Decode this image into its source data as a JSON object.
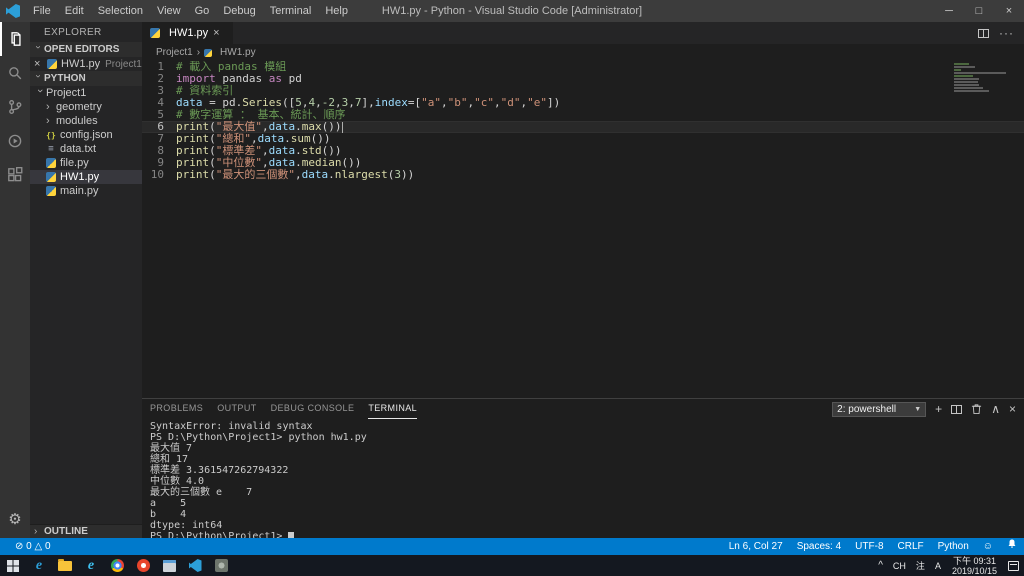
{
  "title_bar": {
    "title": "HW1.py - Python - Visual Studio Code [Administrator]",
    "menus": [
      "File",
      "Edit",
      "Selection",
      "View",
      "Go",
      "Debug",
      "Terminal",
      "Help"
    ]
  },
  "activity_bar": {
    "items": [
      "explorer",
      "search",
      "source-control",
      "debug",
      "extensions"
    ],
    "bottom": "settings"
  },
  "sidebar": {
    "title": "EXPLORER",
    "open_editors": {
      "header": "OPEN EDITORS",
      "items": [
        {
          "file": "HW1.py",
          "folder": "Project1",
          "icon": "py"
        }
      ]
    },
    "workspace": {
      "header": "PYTHON",
      "tree": [
        {
          "label": "Project1",
          "type": "folder-open",
          "level": 0
        },
        {
          "label": "geometry",
          "type": "folder",
          "level": 1
        },
        {
          "label": "modules",
          "type": "folder",
          "level": 1
        },
        {
          "label": "config.json",
          "type": "json",
          "level": 1
        },
        {
          "label": "data.txt",
          "type": "txt",
          "level": 1
        },
        {
          "label": "file.py",
          "type": "py",
          "level": 1
        },
        {
          "label": "HW1.py",
          "type": "py",
          "level": 1,
          "selected": true
        },
        {
          "label": "main.py",
          "type": "py",
          "level": 1
        }
      ]
    },
    "outline_header": "OUTLINE"
  },
  "editor": {
    "tab": "HW1.py",
    "breadcrumb": [
      "Project1",
      "HW1.py"
    ],
    "lines": [
      {
        "num": "1",
        "segs": [
          [
            "c",
            "# 載入 pandas 模組"
          ]
        ]
      },
      {
        "num": "2",
        "segs": [
          [
            "k",
            "import"
          ],
          [
            "p",
            " pandas "
          ],
          [
            "k",
            "as"
          ],
          [
            "p",
            " pd"
          ]
        ]
      },
      {
        "num": "3",
        "segs": [
          [
            "c",
            "# 資料索引"
          ]
        ]
      },
      {
        "num": "4",
        "segs": [
          [
            "v",
            "data"
          ],
          [
            "p",
            " = pd."
          ],
          [
            "f",
            "Series"
          ],
          [
            "p",
            "(["
          ],
          [
            "n",
            "5"
          ],
          [
            "p",
            ","
          ],
          [
            "n",
            "4"
          ],
          [
            "p",
            ","
          ],
          [
            "n",
            "-2"
          ],
          [
            "p",
            ","
          ],
          [
            "n",
            "3"
          ],
          [
            "p",
            ","
          ],
          [
            "n",
            "7"
          ],
          [
            "p",
            "],"
          ],
          [
            "v",
            "index"
          ],
          [
            "p",
            "=["
          ],
          [
            "s",
            "\"a\""
          ],
          [
            "p",
            ","
          ],
          [
            "s",
            "\"b\""
          ],
          [
            "p",
            ","
          ],
          [
            "s",
            "\"c\""
          ],
          [
            "p",
            ","
          ],
          [
            "s",
            "\"d\""
          ],
          [
            "p",
            ","
          ],
          [
            "s",
            "\"e\""
          ],
          [
            "p",
            "])"
          ]
        ]
      },
      {
        "num": "5",
        "segs": [
          [
            "c",
            "# 數字運算 ： 基本、統計、順序"
          ]
        ]
      },
      {
        "num": "6",
        "current": true,
        "segs": [
          [
            "f",
            "print"
          ],
          [
            "p",
            "("
          ],
          [
            "s",
            "\"最大值\""
          ],
          [
            "p",
            ","
          ],
          [
            "v",
            "data"
          ],
          [
            "p",
            "."
          ],
          [
            "f",
            "max"
          ],
          [
            "p",
            "())"
          ]
        ]
      },
      {
        "num": "7",
        "segs": [
          [
            "f",
            "print"
          ],
          [
            "p",
            "("
          ],
          [
            "s",
            "\"總和\""
          ],
          [
            "p",
            ","
          ],
          [
            "v",
            "data"
          ],
          [
            "p",
            "."
          ],
          [
            "f",
            "sum"
          ],
          [
            "p",
            "())"
          ]
        ]
      },
      {
        "num": "8",
        "segs": [
          [
            "f",
            "print"
          ],
          [
            "p",
            "("
          ],
          [
            "s",
            "\"標準差\""
          ],
          [
            "p",
            ","
          ],
          [
            "v",
            "data"
          ],
          [
            "p",
            "."
          ],
          [
            "f",
            "std"
          ],
          [
            "p",
            "())"
          ]
        ]
      },
      {
        "num": "9",
        "segs": [
          [
            "f",
            "print"
          ],
          [
            "p",
            "("
          ],
          [
            "s",
            "\"中位數\""
          ],
          [
            "p",
            ","
          ],
          [
            "v",
            "data"
          ],
          [
            "p",
            "."
          ],
          [
            "f",
            "median"
          ],
          [
            "p",
            "())"
          ]
        ]
      },
      {
        "num": "10",
        "segs": [
          [
            "f",
            "print"
          ],
          [
            "p",
            "("
          ],
          [
            "s",
            "\"最大的三個數\""
          ],
          [
            "p",
            ","
          ],
          [
            "v",
            "data"
          ],
          [
            "p",
            "."
          ],
          [
            "f",
            "nlargest"
          ],
          [
            "p",
            "("
          ],
          [
            "n",
            "3"
          ],
          [
            "p",
            "))"
          ]
        ]
      }
    ]
  },
  "panel": {
    "tabs": [
      {
        "label": "PROBLEMS"
      },
      {
        "label": "OUTPUT"
      },
      {
        "label": "DEBUG CONSOLE"
      },
      {
        "label": "TERMINAL",
        "active": true
      }
    ],
    "shell_selector": "2: powershell",
    "terminal_lines": [
      "SyntaxError: invalid syntax",
      "PS D:\\Python\\Project1> python hw1.py",
      "最大值 7",
      "總和 17",
      "標準差 3.361547262794322",
      "中位數 4.0",
      "最大的三個數 e    7",
      "a    5",
      "b    4",
      "dtype: int64",
      "PS D:\\Python\\Project1> "
    ]
  },
  "status_bar": {
    "errors": "0",
    "warnings": "0",
    "line_col": "Ln 6, Col 27",
    "indent": "Spaces: 4",
    "encoding": "UTF-8",
    "eol": "CRLF",
    "language": "Python"
  },
  "taskbar": {
    "icons": [
      "start",
      "edge",
      "file-explorer",
      "ie",
      "chrome",
      "red-browser",
      "app-window",
      "vscode",
      "gray-app"
    ],
    "tray": {
      "expand": "^",
      "ime": [
        "CH",
        "注",
        "A"
      ],
      "time": "下午 09:31",
      "date": "2019/10/15"
    }
  }
}
